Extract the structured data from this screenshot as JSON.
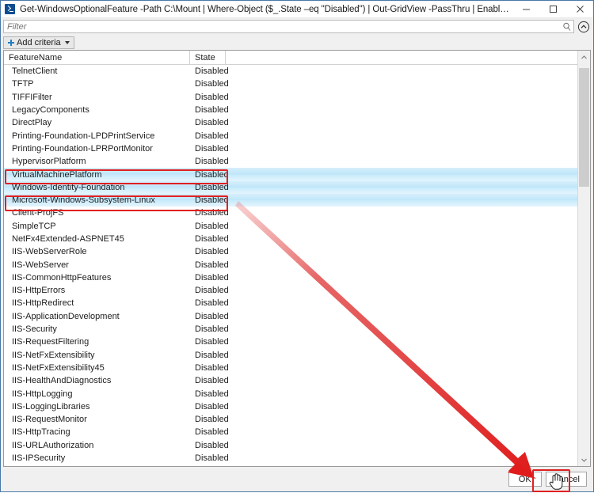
{
  "window": {
    "title": "Get-WindowsOptionalFeature -Path C:\\Mount | Where-Object ($_.State –eq \"Disabled\") | Out-GridView -PassThru | Enable-WindowsOptionalFeature",
    "app_icon": "powershell-icon",
    "controls": {
      "minimize": "minimize-icon",
      "maximize": "maximize-icon",
      "close": "close-icon"
    }
  },
  "filter": {
    "placeholder": "Filter",
    "value": "",
    "search_icon": "search-icon",
    "collapse_icon": "chevron-up-circle-icon"
  },
  "toolbar": {
    "add_criteria_label": "Add criteria",
    "plus_icon": "plus-icon",
    "caret_icon": "chevron-down-icon"
  },
  "grid": {
    "columns": [
      "FeatureName",
      "State"
    ],
    "rows": [
      {
        "name": "TelnetClient",
        "state": "Disabled",
        "selected": false
      },
      {
        "name": "TFTP",
        "state": "Disabled",
        "selected": false
      },
      {
        "name": "TIFFIFilter",
        "state": "Disabled",
        "selected": false
      },
      {
        "name": "LegacyComponents",
        "state": "Disabled",
        "selected": false
      },
      {
        "name": "DirectPlay",
        "state": "Disabled",
        "selected": false
      },
      {
        "name": "Printing-Foundation-LPDPrintService",
        "state": "Disabled",
        "selected": false
      },
      {
        "name": "Printing-Foundation-LPRPortMonitor",
        "state": "Disabled",
        "selected": false
      },
      {
        "name": "HypervisorPlatform",
        "state": "Disabled",
        "selected": false
      },
      {
        "name": "VirtualMachinePlatform",
        "state": "Disabled",
        "selected": true
      },
      {
        "name": "Windows-Identity-Foundation",
        "state": "Disabled",
        "selected": true
      },
      {
        "name": "Microsoft-Windows-Subsystem-Linux",
        "state": "Disabled",
        "selected": true
      },
      {
        "name": "Client-ProjFS",
        "state": "Disabled",
        "selected": false
      },
      {
        "name": "SimpleTCP",
        "state": "Disabled",
        "selected": false
      },
      {
        "name": "NetFx4Extended-ASPNET45",
        "state": "Disabled",
        "selected": false
      },
      {
        "name": "IIS-WebServerRole",
        "state": "Disabled",
        "selected": false
      },
      {
        "name": "IIS-WebServer",
        "state": "Disabled",
        "selected": false
      },
      {
        "name": "IIS-CommonHttpFeatures",
        "state": "Disabled",
        "selected": false
      },
      {
        "name": "IIS-HttpErrors",
        "state": "Disabled",
        "selected": false
      },
      {
        "name": "IIS-HttpRedirect",
        "state": "Disabled",
        "selected": false
      },
      {
        "name": "IIS-ApplicationDevelopment",
        "state": "Disabled",
        "selected": false
      },
      {
        "name": "IIS-Security",
        "state": "Disabled",
        "selected": false
      },
      {
        "name": "IIS-RequestFiltering",
        "state": "Disabled",
        "selected": false
      },
      {
        "name": "IIS-NetFxExtensibility",
        "state": "Disabled",
        "selected": false
      },
      {
        "name": "IIS-NetFxExtensibility45",
        "state": "Disabled",
        "selected": false
      },
      {
        "name": "IIS-HealthAndDiagnostics",
        "state": "Disabled",
        "selected": false
      },
      {
        "name": "IIS-HttpLogging",
        "state": "Disabled",
        "selected": false
      },
      {
        "name": "IIS-LoggingLibraries",
        "state": "Disabled",
        "selected": false
      },
      {
        "name": "IIS-RequestMonitor",
        "state": "Disabled",
        "selected": false
      },
      {
        "name": "IIS-HttpTracing",
        "state": "Disabled",
        "selected": false
      },
      {
        "name": "IIS-URLAuthorization",
        "state": "Disabled",
        "selected": false
      },
      {
        "name": "IIS-IPSecurity",
        "state": "Disabled",
        "selected": false
      }
    ],
    "scrollbar": {
      "up_icon": "chevron-up-icon",
      "down_icon": "chevron-down-icon"
    }
  },
  "buttons": {
    "ok": "OK",
    "cancel": "Cancel"
  },
  "annotations": {
    "highlight_color": "#e02020",
    "boxed_rows": [
      "VirtualMachinePlatform",
      "Microsoft-Windows-Subsystem-Linux"
    ],
    "boxed_button": "OK",
    "arrow": "red-arrow-to-ok-button",
    "cursor": "hand-pointer-cursor"
  }
}
